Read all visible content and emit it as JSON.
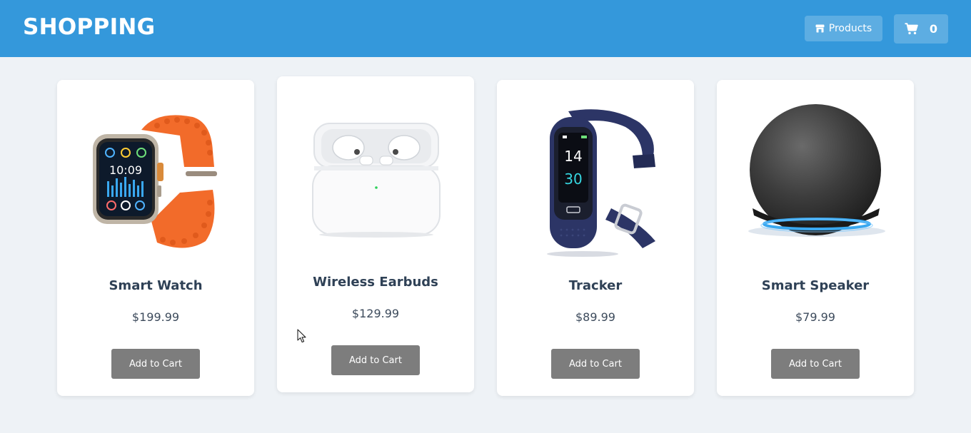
{
  "header": {
    "brand": "SHOPPING",
    "products_label": "Products",
    "cart_count": "0",
    "background": "#3498db",
    "button_bg": "#5dade2"
  },
  "products": [
    {
      "name": "Smart Watch",
      "price": "$199.99",
      "button": "Add to Cart",
      "image": "smart-watch-image"
    },
    {
      "name": "Wireless Earbuds",
      "price": "$129.99",
      "button": "Add to Cart",
      "image": "earbuds-image"
    },
    {
      "name": "Tracker",
      "price": "$89.99",
      "button": "Add to Cart",
      "image": "fitness-tracker-image"
    },
    {
      "name": "Smart Speaker",
      "price": "$79.99",
      "button": "Add to Cart",
      "image": "smart-speaker-image"
    }
  ],
  "colors": {
    "page_bg": "#eef2f6",
    "card_bg": "#ffffff",
    "add_button_bg": "#7d7d7d",
    "watch_band": "#f26b2a",
    "tracker_band": "#2c3566",
    "speaker_ring": "#3aa8f0"
  }
}
